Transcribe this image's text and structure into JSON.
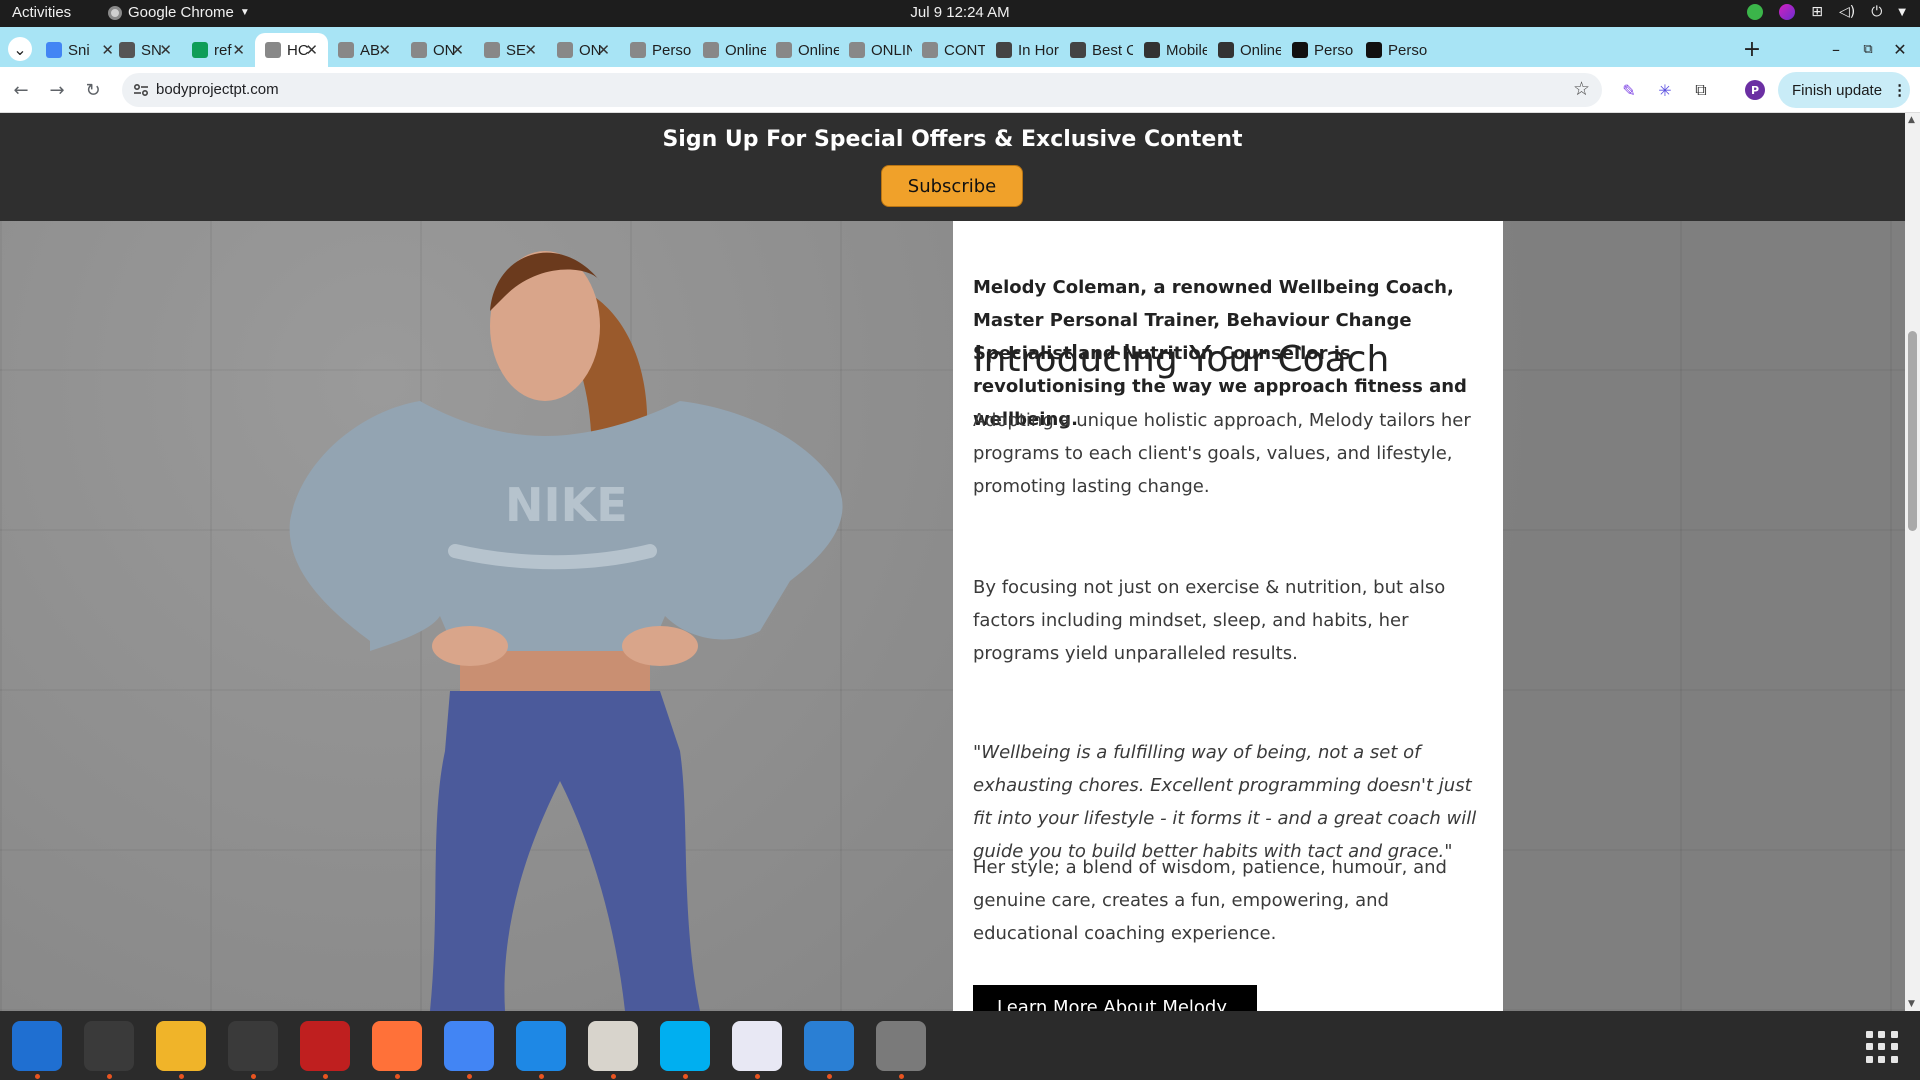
{
  "topbar": {
    "activities": "Activities",
    "app_name": "Google Chrome",
    "clock": "Jul 9  12:24 AM"
  },
  "tabs": [
    {
      "title": "Sni",
      "icon": "docs-icon",
      "color": "#4285f4"
    },
    {
      "title": "SN",
      "icon": "ai-icon",
      "color": "#555555"
    },
    {
      "title": "ref",
      "icon": "sheets-icon",
      "color": "#0f9d58"
    },
    {
      "title": "HC",
      "icon": "site-icon",
      "color": "#888888",
      "active": true
    },
    {
      "title": "AB",
      "icon": "site-icon",
      "color": "#888888"
    },
    {
      "title": "ON",
      "icon": "site-icon",
      "color": "#888888"
    },
    {
      "title": "SE",
      "icon": "site-icon",
      "color": "#888888"
    },
    {
      "title": "ON",
      "icon": "site-icon",
      "color": "#888888"
    },
    {
      "title": "Perso",
      "icon": "site-icon",
      "color": "#888888"
    },
    {
      "title": "Online",
      "icon": "site-icon",
      "color": "#888888"
    },
    {
      "title": "Online",
      "icon": "site-icon",
      "color": "#888888"
    },
    {
      "title": "ONLIN",
      "icon": "site-icon",
      "color": "#888888"
    },
    {
      "title": "CONT",
      "icon": "site-icon",
      "color": "#888888"
    },
    {
      "title": "In Hor",
      "icon": "globe-icon",
      "color": "#444444"
    },
    {
      "title": "Best C",
      "icon": "globe-icon",
      "color": "#444444"
    },
    {
      "title": "Mobile",
      "icon": "mountain-icon",
      "color": "#333333"
    },
    {
      "title": "Online",
      "icon": "mountain-icon",
      "color": "#333333"
    },
    {
      "title": "Perso",
      "icon": "fs-icon",
      "color": "#111111"
    },
    {
      "title": "Perso",
      "icon": "fs-icon",
      "color": "#111111"
    }
  ],
  "toolbar": {
    "url": "bodyprojectpt.com",
    "finish_update": "Finish update",
    "avatar_letter": "P"
  },
  "banner": {
    "heading": "Sign Up For Special Offers & Exclusive Content",
    "subscribe_label": "Subscribe"
  },
  "coach": {
    "title": "Introducing Your Coach",
    "intro": "Melody Coleman, a renowned Wellbeing Coach, Master Personal Trainer, Behaviour Change Specialist and Nutrition Counsellor is revolutionising the way we approach fitness and wellbeing.",
    "p2": "Adopting a unique holistic approach, Melody tailors her programs to each client's goals, values, and lifestyle, promoting lasting change.",
    "p3": "By focusing not just on exercise & nutrition, but also factors including mindset, sleep, and habits, her programs yield unparalleled results.",
    "quote": "\"Wellbeing is a fulfilling way of being, not a set of exhausting chores. Excellent programming doesn't just fit into your lifestyle - it forms it - and a great coach will guide you to build better habits with tact and grace.\"",
    "p5": "Her style; a blend of wisdom, patience, humour, and genuine care, creates a fun, empowering, and educational coaching experience.",
    "learn_more": "Learn More About Melody",
    "hoodie_logo": "NIKE"
  },
  "dock": [
    {
      "name": "thunderbird-app",
      "color": "#1f6fd1"
    },
    {
      "name": "terminal-app",
      "color": "#3a3a3a"
    },
    {
      "name": "calculator-app",
      "color": "#f0b429"
    },
    {
      "name": "system-monitor-app",
      "color": "#3a3a3a"
    },
    {
      "name": "filezilla-app",
      "color": "#bf1f1f"
    },
    {
      "name": "firefox-app",
      "color": "#ff7139"
    },
    {
      "name": "chrome-app",
      "color": "#4285f4"
    },
    {
      "name": "vscode-app",
      "color": "#1e88e5"
    },
    {
      "name": "files-app",
      "color": "#d8d4cc"
    },
    {
      "name": "skype-app",
      "color": "#00aff0"
    },
    {
      "name": "text-editor-app",
      "color": "#e8e8f4"
    },
    {
      "name": "writer-app",
      "color": "#2a7fd4"
    },
    {
      "name": "disks-app",
      "color": "#7a7a7a"
    }
  ]
}
